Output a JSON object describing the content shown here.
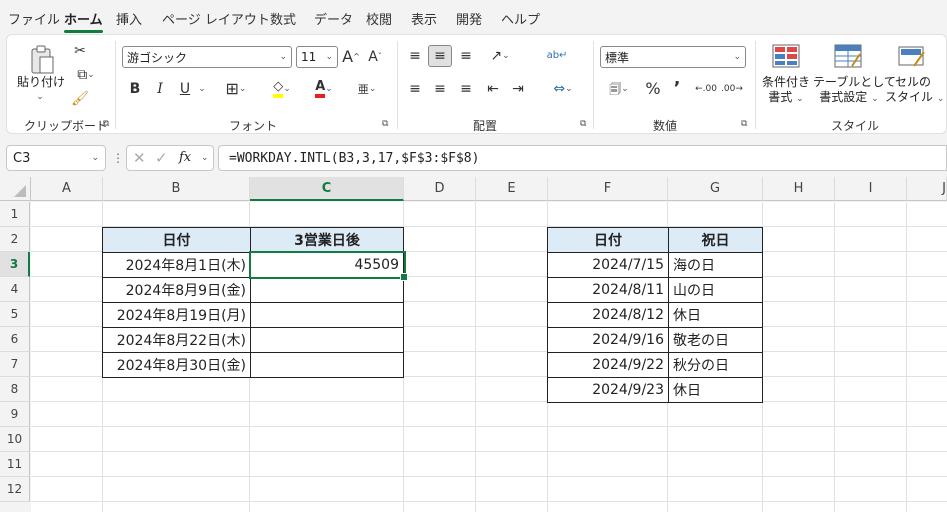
{
  "menu": {
    "tabs": [
      "ファイル",
      "ホーム",
      "挿入",
      "ページ レイアウト",
      "数式",
      "データ",
      "校閲",
      "表示",
      "開発",
      "ヘルプ"
    ],
    "active": "ホーム"
  },
  "ribbon": {
    "clipboard": {
      "paste_label": "貼り付け",
      "group_label": "クリップボード"
    },
    "font": {
      "font_name": "游ゴシック",
      "font_size": "11",
      "group_label": "フォント",
      "font_color": "#e02424",
      "fill_color": "#ffff00",
      "bold": "B",
      "italic": "I",
      "underline": "U"
    },
    "alignment": {
      "group_label": "配置"
    },
    "number": {
      "format": "標準",
      "group_label": "数値",
      "percent": "%",
      "comma": "’"
    },
    "styles": {
      "conditional_line1": "条件付き",
      "conditional_line2": "書式",
      "table_line1": "テーブルとして",
      "table_line2": "書式設定",
      "cell_line1": "セルの",
      "cell_line2": "スタイル",
      "group_label": "スタイル"
    }
  },
  "formula_bar": {
    "name_box": "C3",
    "fx": "fx",
    "formula": "=WORKDAY.INTL(B3,3,17,$F$3:$F$8)"
  },
  "sheet": {
    "columns": [
      "A",
      "B",
      "C",
      "D",
      "E",
      "F",
      "G",
      "H",
      "I",
      "J"
    ],
    "rows": [
      "1",
      "2",
      "3",
      "4",
      "5",
      "6",
      "7",
      "8",
      "9",
      "10",
      "11",
      "12"
    ],
    "selected_column": "C",
    "selected_row": "3",
    "table1": {
      "headers": [
        "日付",
        "3営業日後"
      ],
      "rows": [
        [
          "2024年8月1日(木)",
          "45509"
        ],
        [
          "2024年8月9日(金)",
          ""
        ],
        [
          "2024年8月19日(月)",
          ""
        ],
        [
          "2024年8月22日(木)",
          ""
        ],
        [
          "2024年8月30日(金)",
          ""
        ]
      ]
    },
    "table2": {
      "headers": [
        "日付",
        "祝日"
      ],
      "rows": [
        [
          "2024/7/15",
          "海の日"
        ],
        [
          "2024/8/11",
          "山の日"
        ],
        [
          "2024/8/12",
          "休日"
        ],
        [
          "2024/9/16",
          "敬老の日"
        ],
        [
          "2024/9/22",
          "秋分の日"
        ],
        [
          "2024/9/23",
          "休日"
        ]
      ]
    }
  },
  "colors": {
    "accent": "#107c41",
    "header_fill": "#ddebf7"
  }
}
